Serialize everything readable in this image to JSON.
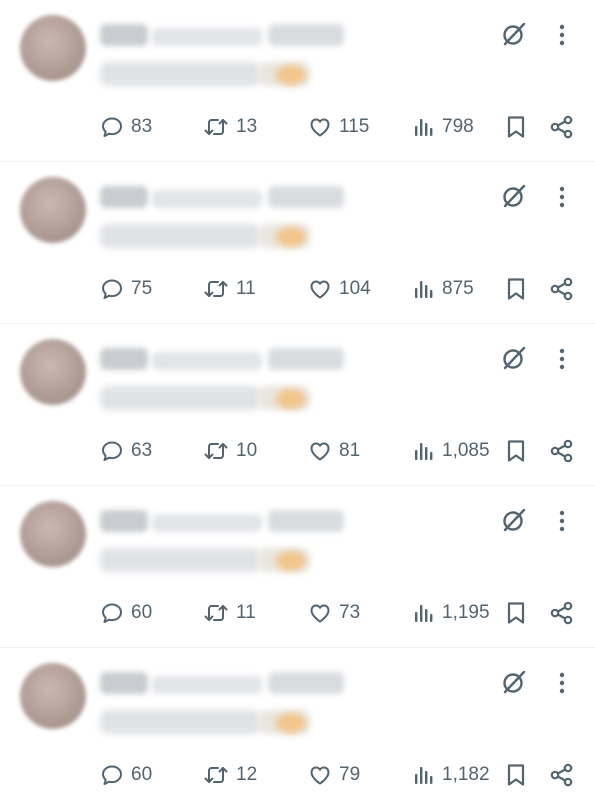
{
  "icons": {
    "reply": "speech-bubble-icon",
    "repost": "repost-arrows-icon",
    "like": "heart-icon",
    "views": "bar-chart-icon",
    "bookmark": "bookmark-icon",
    "share": "share-icon",
    "grok": "grok-slash-circle-icon",
    "more": "vertical-dots-icon"
  },
  "colors": {
    "icon": "#536471",
    "divider": "#eff3f4",
    "background": "#ffffff"
  },
  "posts": [
    {
      "replies": "83",
      "reposts": "13",
      "likes": "115",
      "views": "798"
    },
    {
      "replies": "75",
      "reposts": "11",
      "likes": "104",
      "views": "875"
    },
    {
      "replies": "63",
      "reposts": "10",
      "likes": "81",
      "views": "1,085"
    },
    {
      "replies": "60",
      "reposts": "11",
      "likes": "73",
      "views": "1,195"
    },
    {
      "replies": "60",
      "reposts": "12",
      "likes": "79",
      "views": "1,182"
    }
  ]
}
